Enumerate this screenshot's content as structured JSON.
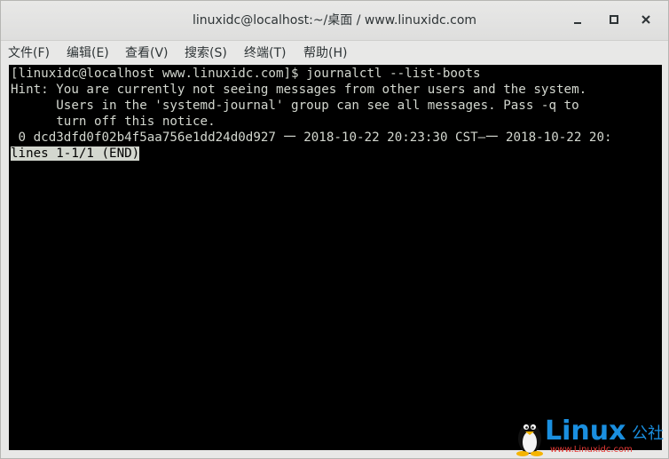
{
  "window": {
    "title": "linuxidc@localhost:~/桌面 / www.linuxidc.com"
  },
  "menubar": {
    "items": [
      {
        "label": "文件(F)"
      },
      {
        "label": "编辑(E)"
      },
      {
        "label": "查看(V)"
      },
      {
        "label": "搜索(S)"
      },
      {
        "label": "终端(T)"
      },
      {
        "label": "帮助(H)"
      }
    ]
  },
  "terminal": {
    "lines": [
      "[linuxidc@localhost www.linuxidc.com]$ journalctl --list-boots",
      "Hint: You are currently not seeing messages from other users and the system.",
      "      Users in the 'systemd-journal' group can see all messages. Pass -q to",
      "      turn off this notice.",
      " 0 dcd3dfd0f02b4f5aa756e1dd24d0d927 一 2018-10-22 20:23:30 CST—一 2018-10-22 20:"
    ],
    "pager_status": "lines 1-1/1 (END)"
  },
  "watermark": {
    "brand": "Linux",
    "brand_cn": "公社",
    "url": "www.Linuxidc.com",
    "color": "#1a8fe0",
    "url_color": "#e53935"
  },
  "colors": {
    "terminal_bg": "#000000",
    "terminal_fg": "#d3d7cf",
    "chrome_bg": "#e8e8e7"
  }
}
